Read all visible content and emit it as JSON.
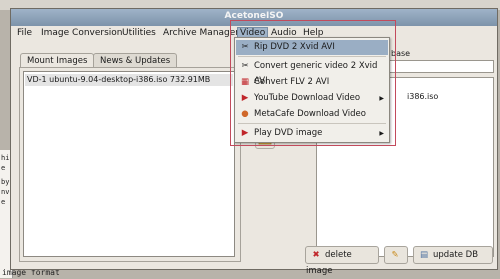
{
  "window": {
    "title": "AcetoneISO"
  },
  "menubar": [
    {
      "id": "file",
      "label": "File"
    },
    {
      "id": "image_conversion",
      "label": "Image Conversion"
    },
    {
      "id": "utilities",
      "label": "Utilities"
    },
    {
      "id": "archive_manager",
      "label": "Archive Manager"
    },
    {
      "id": "video",
      "label": "Video"
    },
    {
      "id": "audio",
      "label": "Audio"
    },
    {
      "id": "help",
      "label": "Help"
    }
  ],
  "tabs": [
    {
      "label": "Mount Images",
      "active": true
    },
    {
      "label": "News & Updates",
      "active": false
    }
  ],
  "mounted_list": {
    "row": "VD-1 ubuntu-9.04-desktop-i386.iso  732.91MB"
  },
  "right_pane": {
    "label": "base",
    "list_text": "i386.iso"
  },
  "buttons": {
    "delete_image": "delete image",
    "update_db": "update DB"
  },
  "video_menu": {
    "items": [
      {
        "label": "Rip DVD 2 Xvid AVI",
        "icon": "scissors-icon",
        "highlighted": true,
        "submenu": false
      },
      {
        "label": "Convert generic video 2 Xvid AVI",
        "icon": "scissors-icon",
        "highlighted": false,
        "submenu": false
      },
      {
        "label": "Convert FLV 2 AVI",
        "icon": "film-icon",
        "highlighted": false,
        "submenu": false
      },
      {
        "label": "YouTube Download Video",
        "icon": "youtube-icon",
        "highlighted": false,
        "submenu": true
      },
      {
        "label": "MetaCafe Download Video",
        "icon": "metacafe-icon",
        "highlighted": false,
        "submenu": false
      },
      {
        "label": "Play DVD image",
        "icon": "play-icon",
        "highlighted": false,
        "submenu": true
      }
    ]
  },
  "background": {
    "terminal_bottom": "image format"
  },
  "colors": {
    "accent": "#9aaec4",
    "highlight_border": "#c24a5c"
  }
}
